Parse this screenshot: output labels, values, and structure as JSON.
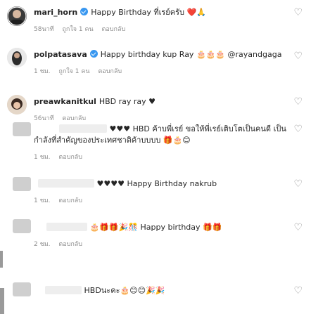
{
  "comments": [
    {
      "username": "mari_horn",
      "verified": true,
      "text": "Happy Birthday ที่เรย์ครับ ❤️🙏",
      "time": "58นาที",
      "likes": "ถูกใจ 1 คน",
      "reply": "ตอบกลับ"
    },
    {
      "username": "polpatasava",
      "verified": true,
      "text": "Happy birthday kup Ray 🎂🎂🎂 @rayandgaga",
      "time": "1 ชม.",
      "likes": "ถูกใจ 1 คน",
      "reply": "ตอบกลับ"
    },
    {
      "username": "preawkanitkul",
      "verified": false,
      "text": "HBD ray ray ♥",
      "time": "56นาที",
      "likes": "",
      "reply": "ตอบกลับ"
    },
    {
      "username": "",
      "verified": false,
      "text": "♥♥♥ HBD ค้าบพี่เรย์ ขอให้พี่เรย์เติบโตเป็นคนดี เป็น",
      "text2": "กำลังที่สำคัญของประเทศชาติค้าบบบบ 🎁🎂😊",
      "time": "1 ชม.",
      "likes": "",
      "reply": "ตอบกลับ"
    },
    {
      "username": "",
      "verified": false,
      "text": "♥♥♥♥ Happy Birthday nakrub",
      "time": "1 ชม.",
      "likes": "",
      "reply": "ตอบกลับ"
    },
    {
      "username": "",
      "verified": false,
      "text": "🎂🎁🎁🎉🎊 Happy birthday 🎁🎁",
      "time": "2 ชม.",
      "likes": "",
      "reply": "ตอบกลับ"
    },
    {
      "username": "",
      "verified": false,
      "text": "HBDนะคะ🎂😊😊🎉🎉",
      "time": "",
      "likes": "",
      "reply": ""
    }
  ],
  "icons": {
    "heart": "heart-outline-icon",
    "verified": "verified-badge-icon"
  },
  "colors": {
    "meta_text": "#8e8e8e",
    "verified_blue": "#3897f0"
  }
}
